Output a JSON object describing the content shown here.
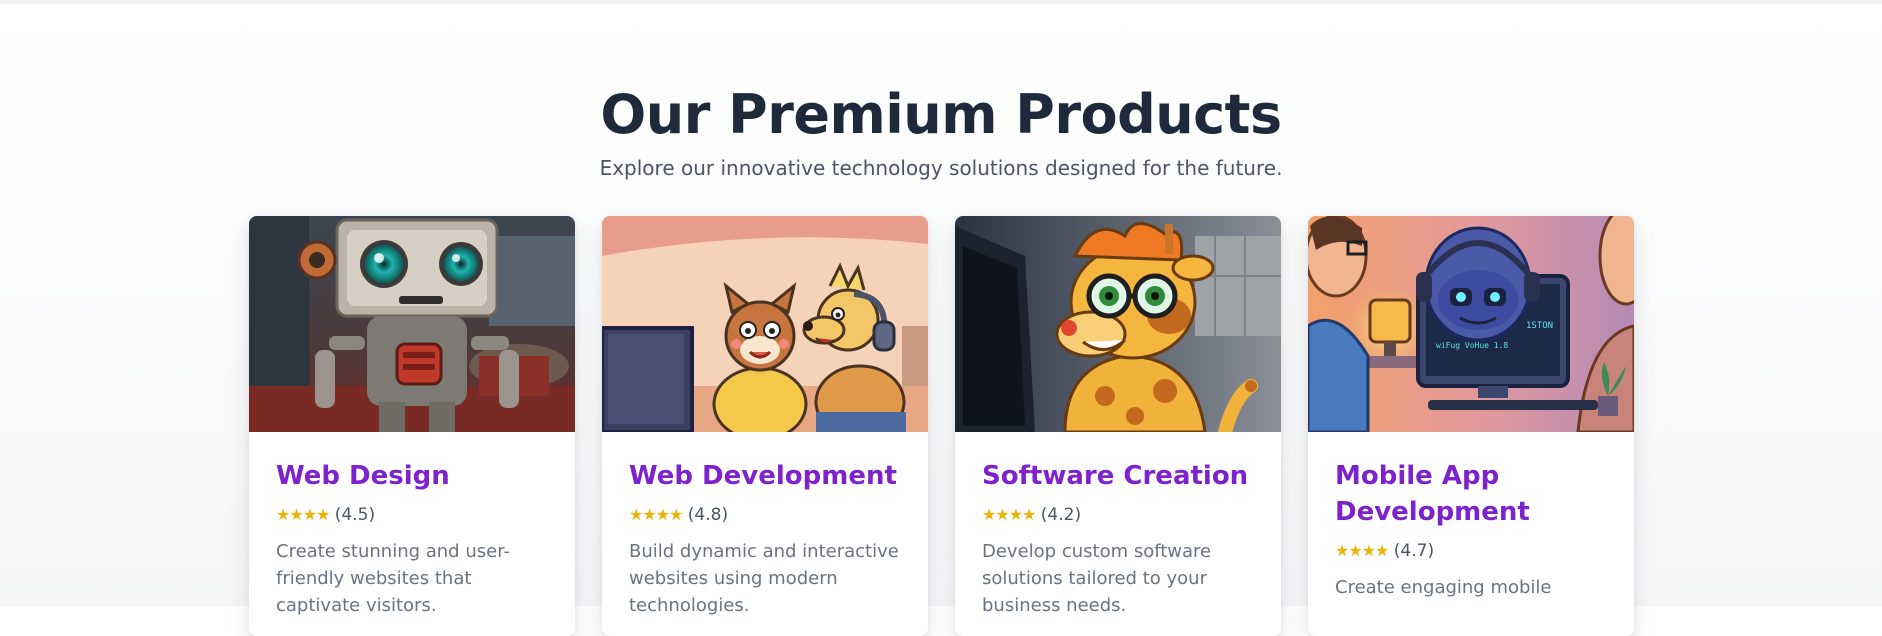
{
  "section": {
    "title": "Our Premium Products",
    "subtitle": "Explore our innovative technology solutions designed for the future."
  },
  "products": [
    {
      "title": "Web Design",
      "stars": "★★★★",
      "rating": "(4.5)",
      "description": "Create stunning and user-friendly websites that captivate visitors.",
      "image": "robot-illustration"
    },
    {
      "title": "Web Development",
      "stars": "★★★★",
      "rating": "(4.8)",
      "description": "Build dynamic and interactive websites using modern technologies.",
      "image": "cartoon-animals-at-computer"
    },
    {
      "title": "Software Creation",
      "stars": "★★★★",
      "rating": "(4.2)",
      "description": "Develop custom software solutions tailored to your business needs.",
      "image": "cartoon-giraffe-with-glasses"
    },
    {
      "title": "Mobile App Development",
      "stars": "★★★★",
      "rating": "(4.7)",
      "description": "Create engaging mobile",
      "image": "robot-with-headphones-at-monitor"
    }
  ],
  "colors": {
    "title": "#1e293b",
    "accent": "#7e22ce",
    "star": "#eab308"
  }
}
